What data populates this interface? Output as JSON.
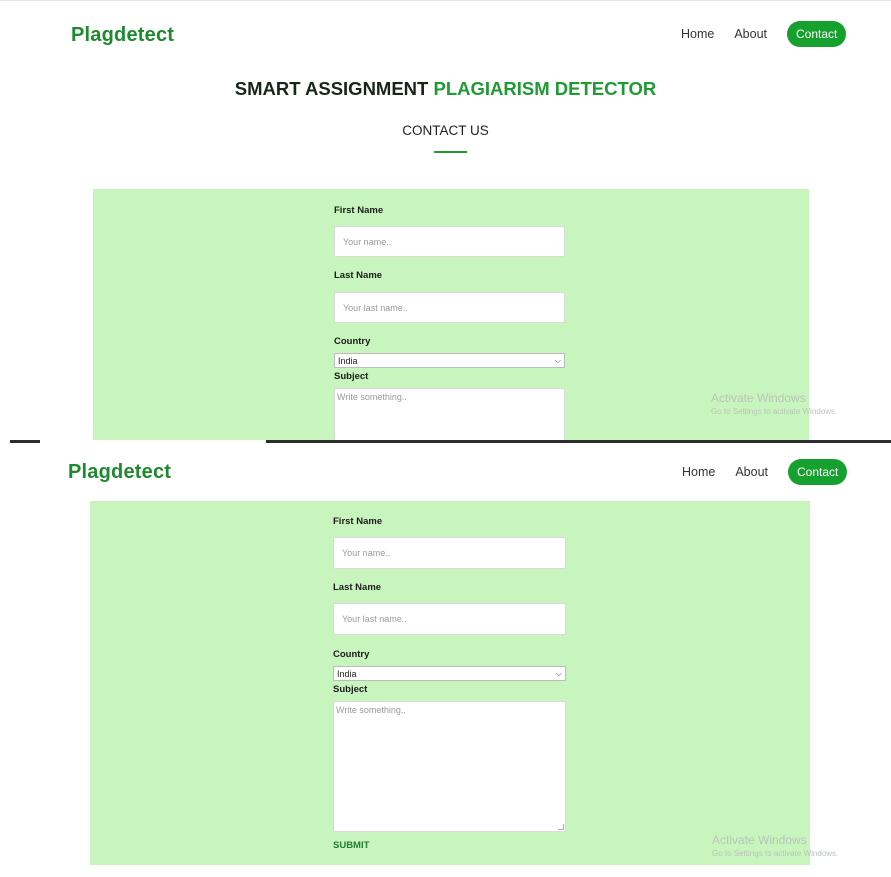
{
  "site": {
    "brand": "Plagdetect",
    "nav": {
      "home": "Home",
      "about": "About",
      "contact": "Contact"
    }
  },
  "hero": {
    "title_part1": "SMART ASSIGNMENT ",
    "title_part2": "PLAGIARISM DETECTOR",
    "section_heading": "CONTACT US"
  },
  "form": {
    "first_name_label": "First Name",
    "first_name_placeholder": "Your name..",
    "last_name_label": "Last Name",
    "last_name_placeholder": "Your last name..",
    "country_label": "Country",
    "country_value": "India",
    "subject_label": "Subject",
    "subject_placeholder": "Write something..",
    "submit_label": "SUBMIT"
  },
  "watermark": {
    "title": "Activate Windows",
    "subtitle": "Go to Settings to activate Windows."
  },
  "colors": {
    "brand_green": "#1e8a2e",
    "button_green": "#16a02e",
    "panel_green": "#c8f5bd"
  }
}
